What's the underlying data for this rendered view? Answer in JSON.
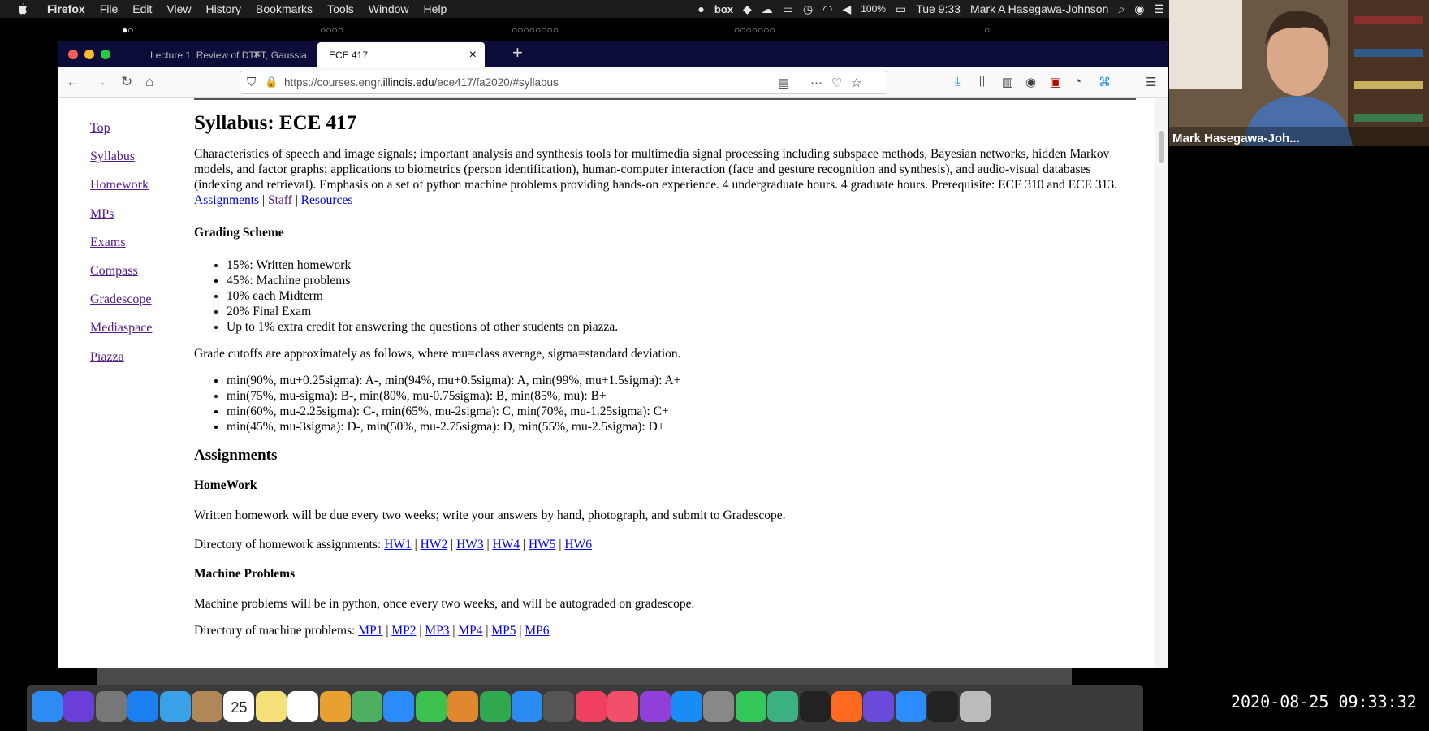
{
  "menubar": {
    "app": "Firefox",
    "items": [
      "File",
      "Edit",
      "View",
      "History",
      "Bookmarks",
      "Tools",
      "Window",
      "Help"
    ],
    "battery": "100%",
    "clock": "Tue 9:33",
    "user": "Mark A Hasegawa-Johnson",
    "status_icons": [
      "creative-cloud-icon",
      "box-icon",
      "dropbox-icon",
      "cloud-icon",
      "display-icon",
      "time-machine-icon",
      "wifi-icon",
      "volume-icon",
      "battery-icon",
      "search-icon",
      "siri-icon",
      "list-icon"
    ]
  },
  "dot_groups": [
    "●○",
    "○○○○",
    "○○○○○○○○",
    "○○○○○○○",
    "○"
  ],
  "browser": {
    "tabs": [
      {
        "label": "Lecture 1: Review of DTFT, Gaussia",
        "active": false
      },
      {
        "label": "ECE 417",
        "active": true
      }
    ],
    "url_prefix": "https://courses.engr.",
    "url_domain": "illinois.edu",
    "url_path": "/ece417/fa2020/#syllabus"
  },
  "sidenav": [
    "Top",
    "Syllabus",
    "Homework",
    "MPs",
    "Exams",
    "Compass",
    "Gradescope",
    "Mediaspace",
    "Piazza"
  ],
  "page": {
    "title": "Syllabus: ECE 417",
    "description": "Characteristics of speech and image signals; important analysis and synthesis tools for multimedia signal processing including subspace methods, Bayesian networks, hidden Markov models, and factor graphs; applications to biometrics (person identification), human-computer interaction (face and gesture recognition and synthesis), and audio-visual databases (indexing and retrieval). Emphasis on a set of python machine problems providing hands-on experience. 4 undergraduate hours. 4 graduate hours. Prerequisite: ECE 310 and ECE 313.",
    "desc_links": [
      "Assignments",
      "Staff",
      "Resources"
    ],
    "sep": "|",
    "grading_heading": "Grading Scheme",
    "grading_items": [
      "15%: Written homework",
      "45%: Machine problems",
      "10% each Midterm",
      "20% Final Exam",
      "Up to 1% extra credit for answering the questions of other students on piazza."
    ],
    "cutoffs_intro": "Grade cutoffs are approximately as follows, where mu=class average, sigma=standard deviation.",
    "cutoffs": [
      "min(90%, mu+0.25sigma): A-, min(94%, mu+0.5sigma): A, min(99%, mu+1.5sigma): A+",
      "min(75%, mu-sigma): B-, min(80%, mu-0.75sigma): B, min(85%, mu): B+",
      "min(60%, mu-2.25sigma): C-, min(65%, mu-2sigma): C, min(70%, mu-1.25sigma): C+",
      "min(45%, mu-3sigma): D-, min(50%, mu-2.75sigma): D, min(55%, mu-2.5sigma): D+"
    ],
    "assignments_heading": "Assignments",
    "homework_heading": "HomeWork",
    "homework_text": "Written homework will be due every two weeks; write your answers by hand, photograph, and submit to Gradescope.",
    "homework_dir": "Directory of homework assignments:",
    "hw_links": [
      "HW1",
      "HW2",
      "HW3",
      "HW4",
      "HW5",
      "HW6"
    ],
    "mp_heading": "Machine Problems",
    "mp_text": "Machine problems will be in python, once every two weeks, and will be autograded on gradescope.",
    "mp_dir": "Directory of machine problems:",
    "mp_links": [
      "MP1",
      "MP2",
      "MP3",
      "MP4",
      "MP5",
      "MP6"
    ]
  },
  "video": {
    "name": "Mark Hasegawa-Joh..."
  },
  "dock_apps": [
    "finder",
    "siri",
    "launchpad",
    "safari",
    "preview",
    "contacts",
    "calendar",
    "notes",
    "reminders",
    "photos",
    "maps",
    "messages",
    "facetime",
    "keynote-doc",
    "numbers",
    "keynote",
    "help",
    "news",
    "music",
    "podcasts",
    "app-store",
    "system-preferences",
    "line",
    "atom",
    "terminal",
    "firefox",
    "emacs",
    "zoom",
    "acrobat",
    "trash"
  ],
  "calendar_date": "25",
  "timestamp": "2020-08-25 09:33:32"
}
